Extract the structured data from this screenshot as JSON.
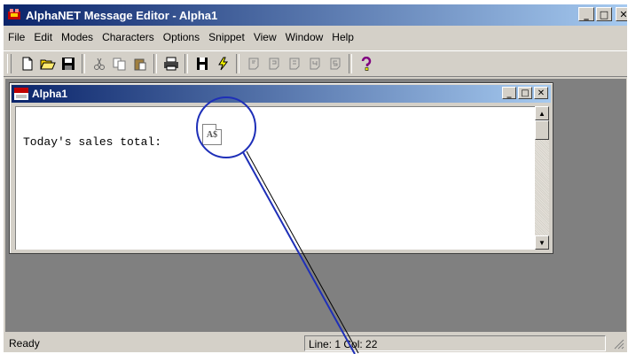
{
  "window": {
    "title": "AlphaNET Message Editor - Alpha1"
  },
  "menubar": {
    "items": [
      "File",
      "Edit",
      "Modes",
      "Characters",
      "Options",
      "Snippet",
      "View",
      "Window",
      "Help"
    ]
  },
  "toolbar": {
    "icons": [
      "new-document-icon",
      "open-folder-icon",
      "save-disk-icon",
      "cut-icon",
      "copy-icon",
      "paste-icon",
      "print-icon",
      "send-icon",
      "lightning-icon",
      "page-icon-1",
      "page-icon-2",
      "page-icon-3",
      "page-icon-4",
      "page-icon-5",
      "help-question-icon"
    ]
  },
  "child_window": {
    "title": "Alpha1"
  },
  "editor": {
    "text": "Today's sales total:",
    "token_label": "A$"
  },
  "statusbar": {
    "ready": "Ready",
    "position": "Line: 1  Col: 22"
  },
  "colors": {
    "title_start": "#0a246a",
    "title_end": "#a6caf0",
    "callout": "#1e2fb8",
    "face": "#d4d0c8",
    "workspace": "#808080"
  }
}
